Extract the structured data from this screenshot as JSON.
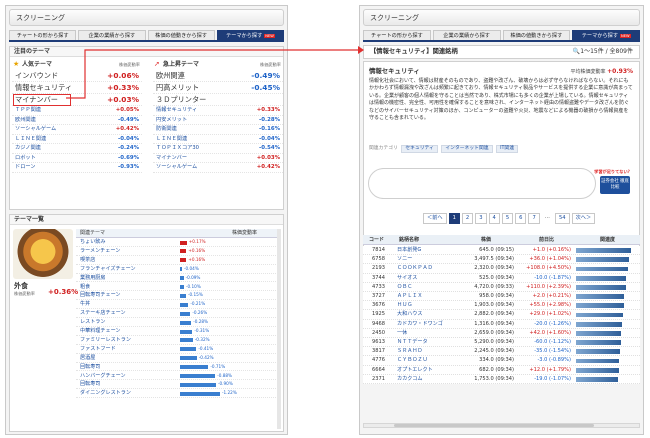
{
  "left": {
    "title": "スクリーニング",
    "tabs": [
      {
        "label": "チャートの形から探す"
      },
      {
        "label": "企業の業績から探す"
      },
      {
        "label": "株価の値動きから探す"
      },
      {
        "label": "テーマから探す",
        "badge": "NEW"
      }
    ],
    "featured": {
      "heading": "注目のテーマ",
      "popular_heading": "人気テーマ",
      "rising_heading": "急上昇テーマ",
      "rate_label": "株価変動率",
      "popular": [
        {
          "name": "インバウンド",
          "value": "+0.06%",
          "sign": "pos"
        },
        {
          "name": "情報セキュリティ",
          "value": "+0.33%",
          "sign": "pos"
        },
        {
          "name": "マイナンバー",
          "value": "+0.03%",
          "sign": "pos"
        },
        {
          "name": "ＴＰＰ関連",
          "value": "+0.05%",
          "sign": "pos"
        },
        {
          "name": "欧州関連",
          "value": "-0.49%",
          "sign": "neg"
        },
        {
          "name": "ソーシャルゲーム",
          "value": "+0.42%",
          "sign": "pos"
        },
        {
          "name": "ＬＩＮＥ関連",
          "value": "-0.04%",
          "sign": "neg"
        },
        {
          "name": "カジノ関連",
          "value": "-0.24%",
          "sign": "neg"
        },
        {
          "name": "ロボット",
          "value": "-0.69%",
          "sign": "neg"
        },
        {
          "name": "ドローン",
          "value": "-0.93%",
          "sign": "neg"
        }
      ],
      "rising": [
        {
          "name": "欧州関連",
          "value": "-0.49%",
          "sign": "neg"
        },
        {
          "name": "円高メリット",
          "value": "-0.45%",
          "sign": "neg"
        },
        {
          "name": "３Ｄプリンター",
          "value": "",
          "sign": "neg"
        },
        {
          "name": "情報セキュリティ",
          "value": "+0.33%",
          "sign": "pos"
        },
        {
          "name": "円安メリット",
          "value": "-0.28%",
          "sign": "neg"
        },
        {
          "name": "防衛関連",
          "value": "-0.16%",
          "sign": "neg"
        },
        {
          "name": "ＬＩＮＥ関連",
          "value": "-0.04%",
          "sign": "neg"
        },
        {
          "name": "ＴＯＰＩＸコア30",
          "value": "-0.54%",
          "sign": "neg"
        },
        {
          "name": "マイナンバー",
          "value": "+0.03%",
          "sign": "pos"
        },
        {
          "name": "ソーシャルゲーム",
          "value": "+0.42%",
          "sign": "pos"
        }
      ]
    },
    "theme_list": {
      "heading": "テーマ一覧",
      "category_label": "外食",
      "category_sub": "株価変動率",
      "category_value": "+0.36%",
      "col_theme": "関連テーマ",
      "col_rate": "株価変動率",
      "items": [
        {
          "name": "ちょい飲み",
          "value": "+0.17%",
          "fraction": 0.17
        },
        {
          "name": "ラーメンチェーン",
          "value": "+0.16%",
          "fraction": 0.16
        },
        {
          "name": "喫茶店",
          "value": "+0.16%",
          "fraction": 0.16
        },
        {
          "name": "フランチャイズチェーン",
          "value": "-0.04%",
          "fraction": 0.04
        },
        {
          "name": "業務用厨房",
          "value": "-0.09%",
          "fraction": 0.09
        },
        {
          "name": "粗食",
          "value": "-0.10%",
          "fraction": 0.1
        },
        {
          "name": "回転寿司チェーン",
          "value": "-0.15%",
          "fraction": 0.15
        },
        {
          "name": "牛丼",
          "value": "-0.21%",
          "fraction": 0.21
        },
        {
          "name": "ステーキ店チェーン",
          "value": "-0.26%",
          "fraction": 0.26
        },
        {
          "name": "レストラン",
          "value": "-0.28%",
          "fraction": 0.28
        },
        {
          "name": "中華料理チェーン",
          "value": "-0.31%",
          "fraction": 0.31
        },
        {
          "name": "ファミリーレストラン",
          "value": "-0.32%",
          "fraction": 0.32
        },
        {
          "name": "ファストフード",
          "value": "-0.41%",
          "fraction": 0.41
        },
        {
          "name": "居酒屋",
          "value": "-0.42%",
          "fraction": 0.42
        },
        {
          "name": "回転寿司",
          "value": "-0.71%",
          "fraction": 0.71
        },
        {
          "name": "ハンバーグチェーン",
          "value": "-0.88%",
          "fraction": 0.88
        },
        {
          "name": "回転寿司",
          "value": "-0.90%",
          "fraction": 0.9
        },
        {
          "name": "ダイニングレストラン",
          "value": "-1.22%",
          "fraction": 1.0
        }
      ]
    }
  },
  "right": {
    "title": "スクリーニング",
    "tabs": [
      {
        "label": "チャートの形から探す"
      },
      {
        "label": "企業の業績から探す"
      },
      {
        "label": "株価の値動きから探す"
      },
      {
        "label": "テーマから探す",
        "badge": "NEW"
      }
    ],
    "result_title": "【情報セキュリティ】関連銘柄",
    "result_count": "1〜15件 / 全809件",
    "theme_name": "情報セキュリティ",
    "avg_label": "平均株価変動率",
    "avg_value": "+0.93%",
    "description": "情報化社会において、情報は財産そのものであり、盗難や改ざん、破壊からは必ず守らなければならない。それにもかかわらず情報漏洩や改ざんは頻繁に起きており、情報セキュリティ製品やサービスを提供する企業に意識が高まっている。企業が顧客の個人情報を守ることは当然であり、株式市場にも多くの企業が上場している。情報セキュリティは情報の機密性、完全性、可用性を確保することを意味され、インターネット経由の情報盗難やデータ改ざんを防ぐなどのサイバーセキュリティ対策のほか、コンピューターの盗難や火災、地震などによる機器の破損から情報資産を守ることも含まれている。",
    "related_label": "関連カテゴリ",
    "related_tags": [
      "セキュリティ",
      "インターネット関連",
      "IT関連"
    ],
    "promo_question": "学習が足りてない？",
    "promo_button": "証券会社 徹底比較",
    "pager": {
      "prev": "＜前へ",
      "pages": [
        "1",
        "2",
        "3",
        "4",
        "5",
        "6",
        "7"
      ],
      "dots": "…",
      "last": "54",
      "next": "次へ＞"
    },
    "table": {
      "headers": {
        "code": "コード",
        "name": "銘柄名称",
        "price": "株価",
        "change": "前日比",
        "relevance": "関連度"
      },
      "rows": [
        {
          "code": "7814",
          "name": "日本創発G",
          "price": "645.0 (09:15)",
          "change": "+1.0 (+0.16%)",
          "sign": "pos",
          "relevance": 0.88
        },
        {
          "code": "6758",
          "name": "ソニー",
          "price": "3,497.5 (09:34)",
          "change": "+36.0 (+1.04%)",
          "sign": "pos",
          "relevance": 0.86
        },
        {
          "code": "2193",
          "name": "ＣＯＯＫＰＡＤ",
          "price": "2,320.0 (09:34)",
          "change": "+108.0 (+4.50%)",
          "sign": "pos",
          "relevance": 0.84
        },
        {
          "code": "3744",
          "name": "サイオス",
          "price": "525.0 (09:34)",
          "change": "-10.0 (-1.87%)",
          "sign": "neg",
          "relevance": 0.8
        },
        {
          "code": "4733",
          "name": "ＯＢＣ",
          "price": "4,720.0 (09:33)",
          "change": "+110.0 (+2.39%)",
          "sign": "pos",
          "relevance": 0.8
        },
        {
          "code": "3727",
          "name": "ＡＰＬＩＸ",
          "price": "958.0 (09:34)",
          "change": "+2.0 (+0.21%)",
          "sign": "pos",
          "relevance": 0.78
        },
        {
          "code": "3676",
          "name": "ＨＵＧ",
          "price": "1,903.0 (09:34)",
          "change": "+55.0 (+2.98%)",
          "sign": "pos",
          "relevance": 0.77
        },
        {
          "code": "1925",
          "name": "大和ハウス",
          "price": "2,882.0 (09:34)",
          "change": "+29.0 (+1.02%)",
          "sign": "pos",
          "relevance": 0.76
        },
        {
          "code": "9468",
          "name": "カドカワ・ドワンゴ",
          "price": "1,316.0 (09:34)",
          "change": "-20.0 (-1.26%)",
          "sign": "neg",
          "relevance": 0.74
        },
        {
          "code": "2450",
          "name": "一休",
          "price": "2,659.0 (09:34)",
          "change": "+42.0 (+1.60%)",
          "sign": "pos",
          "relevance": 0.73
        },
        {
          "code": "9613",
          "name": "ＮＴＴデータ",
          "price": "5,290.0 (09:34)",
          "change": "-60.0 (-1.12%)",
          "sign": "neg",
          "relevance": 0.72
        },
        {
          "code": "3817",
          "name": "ＳＲＡＨＤ",
          "price": "2,245.0 (09:34)",
          "change": "-35.0 (-1.54%)",
          "sign": "neg",
          "relevance": 0.71
        },
        {
          "code": "4776",
          "name": "ＣＹＢＯＺＵ",
          "price": "334.0 (09:34)",
          "change": "-3.0 (-0.89%)",
          "sign": "neg",
          "relevance": 0.7
        },
        {
          "code": "6664",
          "name": "オプトエレクト",
          "price": "682.0 (09:34)",
          "change": "+12.0 (+1.79%)",
          "sign": "pos",
          "relevance": 0.69
        },
        {
          "code": "2371",
          "name": "カカクコム",
          "price": "1,753.0 (09:34)",
          "change": "-19.0 (-1.07%)",
          "sign": "neg",
          "relevance": 0.68
        }
      ]
    }
  },
  "colors": {
    "accent": "#1e3c78",
    "positive": "#d02020",
    "negative": "#1e63c8",
    "highlight": "#e03030"
  }
}
